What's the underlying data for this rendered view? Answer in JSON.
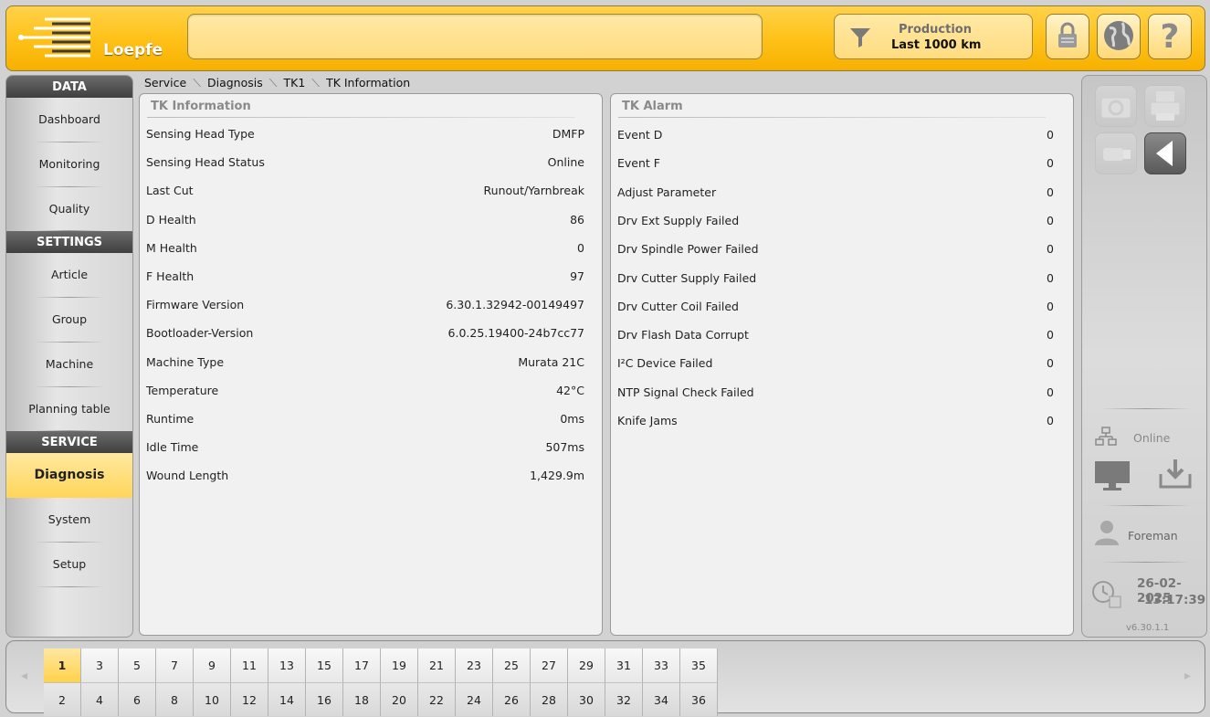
{
  "header": {
    "logo_text": "Loepfe",
    "production_title": "Production",
    "production_value": "Last 1000 km",
    "accent": "#ffc21a",
    "icons": [
      "lock-icon",
      "globe-icon",
      "help-icon"
    ]
  },
  "nav": {
    "data_head": "DATA",
    "data_items": [
      "Dashboard",
      "Monitoring",
      "Quality"
    ],
    "settings_head": "SETTINGS",
    "settings_items": [
      "Article",
      "Group",
      "Machine",
      "Planning table"
    ],
    "service_head": "SERVICE",
    "service_items": [
      "Diagnosis",
      "System",
      "Setup"
    ],
    "active": "Diagnosis"
  },
  "breadcrumb": [
    "Service",
    "Diagnosis",
    "TK1",
    "TK Information"
  ],
  "tk_information": {
    "title": "TK Information",
    "rows": [
      {
        "label": "Sensing Head Type",
        "value": "DMFP"
      },
      {
        "label": "Sensing Head Status",
        "value": "Online"
      },
      {
        "label": "Last Cut",
        "value": "Runout/Yarnbreak"
      },
      {
        "label": "D Health",
        "value": "86"
      },
      {
        "label": "M Health",
        "value": "0"
      },
      {
        "label": "F Health",
        "value": "97"
      },
      {
        "label": "Firmware Version",
        "value": "6.30.1.32942-00149497"
      },
      {
        "label": "Bootloader-Version",
        "value": "6.0.25.19400-24b7cc77"
      },
      {
        "label": "Machine Type",
        "value": "Murata 21C"
      },
      {
        "label": "Temperature",
        "value": "42°C"
      },
      {
        "label": "Runtime",
        "value": "0ms"
      },
      {
        "label": "Idle Time",
        "value": "507ms"
      },
      {
        "label": "Wound Length",
        "value": "1,429.9m"
      }
    ]
  },
  "tk_alarm": {
    "title": "TK Alarm",
    "rows": [
      {
        "label": "Event D",
        "value": "0"
      },
      {
        "label": "Event F",
        "value": "0"
      },
      {
        "label": "Adjust Parameter",
        "value": "0"
      },
      {
        "label": "Drv Ext Supply Failed",
        "value": "0"
      },
      {
        "label": "Drv Spindle Power Failed",
        "value": "0"
      },
      {
        "label": "Drv Cutter Supply Failed",
        "value": "0"
      },
      {
        "label": "Drv Cutter Coil Failed",
        "value": "0"
      },
      {
        "label": "Drv Flash Data Corrupt",
        "value": "0"
      },
      {
        "label": "I²C Device Failed",
        "value": "0"
      },
      {
        "label": "NTP Signal Check Failed",
        "value": "0"
      },
      {
        "label": "Knife Jams",
        "value": "0"
      }
    ]
  },
  "right_bar": {
    "status": "Online",
    "user": "Foreman",
    "date": "26-02-2025",
    "time": "13:17:39",
    "version": "v6.30.1.1"
  },
  "spindles": {
    "odd": [
      "1",
      "3",
      "5",
      "7",
      "9",
      "11",
      "13",
      "15",
      "17",
      "19",
      "21",
      "23",
      "25",
      "27",
      "29",
      "31",
      "33",
      "35"
    ],
    "even": [
      "2",
      "4",
      "6",
      "8",
      "10",
      "12",
      "14",
      "16",
      "18",
      "20",
      "22",
      "24",
      "26",
      "28",
      "30",
      "32",
      "34",
      "36"
    ],
    "selected": "1"
  }
}
